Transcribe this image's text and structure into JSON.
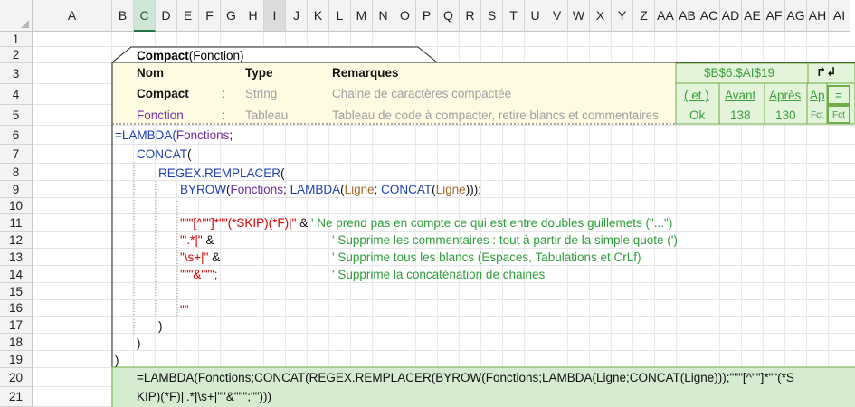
{
  "columns": [
    "A",
    "B",
    "C",
    "D",
    "E",
    "F",
    "G",
    "H",
    "I",
    "J",
    "K",
    "L",
    "M",
    "N",
    "O",
    "P",
    "Q",
    "R",
    "S",
    "T",
    "U",
    "V",
    "W",
    "X",
    "Y",
    "Z",
    "AA",
    "AB",
    "AC",
    "AD",
    "AE",
    "AF",
    "AG",
    "AH",
    "AI"
  ],
  "rows": [
    "1",
    "2",
    "3",
    "4",
    "5",
    "6",
    "7",
    "8",
    "9",
    "10",
    "11",
    "12",
    "13",
    "14",
    "15",
    "16",
    "17",
    "18",
    "19",
    "20",
    "21"
  ],
  "header": {
    "tab_title_bold": "Compact",
    "tab_title_rest": "(Fonction)",
    "col_nom": "Nom",
    "col_type": "Type",
    "col_remarques": "Remarques",
    "params": [
      {
        "name": "Compact",
        "sep": ":",
        "type": "String",
        "remark": "Chaine de caractères compactée"
      },
      {
        "name": "Fonction",
        "sep": ":",
        "type": "Tableau",
        "remark": "Tableau de code à compacter, retire blancs et commentaires"
      }
    ]
  },
  "status": {
    "range": "$B$6:$AI$19",
    "arrow": "↱↲",
    "et_label": "( et )",
    "avant_label": "Avant",
    "apres_label": "Après",
    "ap_label": "Ap",
    "eq_label": "=",
    "ok": "Ok",
    "avant": "138",
    "apres": "130",
    "fct1": "Fct",
    "fct2": "Fct"
  },
  "code": {
    "l6": [
      "=LAMBDA(",
      "Fonctions",
      ";"
    ],
    "l7": [
      "CONCAT",
      "("
    ],
    "l8": [
      "REGEX.REMPLACER",
      "("
    ],
    "l9": [
      "BYROW",
      "(",
      "Fonctions",
      "; ",
      "LAMBDA",
      "(",
      "Ligne",
      "; ",
      "CONCAT",
      "(",
      "Ligne",
      ")));"
    ],
    "l11": [
      "\"\"\"[^\"\"]*\"\"(*SKIP)(*F)|\" ",
      "& ",
      "' Ne prend pas en compte ce qui est entre doubles guillemets (\"...\")"
    ],
    "l12": [
      "\"'.*|\" ",
      "& ",
      "' Supprime les commentaires : tout à partir de la simple quote (')"
    ],
    "l13": [
      "\"\\s+|\" ",
      "& ",
      "' Supprime tous les blancs (Espaces, Tabulations et CrLf)"
    ],
    "l14": [
      "\"\"\"&\"\"\";",
      "' Supprime la concaténation de chaines"
    ],
    "l16": "\"\"",
    "l17": ")",
    "l18": ")",
    "l19": ")"
  },
  "result": {
    "line1": "=LAMBDA(Fonctions;CONCAT(REGEX.REMPLACER(BYROW(Fonctions;LAMBDA(Ligne;CONCAT(Ligne)));\"\"\"[^\"\"]*\"\"(*S",
    "line2": "KIP)(*F)|'.*|\\s+|\"\"&\"\"\";\"\")))"
  },
  "colors": {
    "header_fill": "#fffbe3",
    "green_fill": "#e3f4da",
    "green_border": "#70ad47",
    "result_fill": "#d5ecd0",
    "select_green": "#217346"
  }
}
